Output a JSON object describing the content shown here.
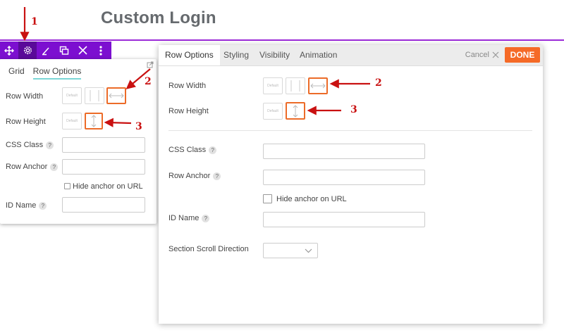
{
  "page": {
    "title": "Custom Login"
  },
  "toolbar": {
    "buttons": [
      {
        "icon": "move-icon"
      },
      {
        "icon": "gear-icon"
      },
      {
        "icon": "brush-icon"
      },
      {
        "icon": "duplicate-icon"
      },
      {
        "icon": "close-icon"
      },
      {
        "icon": "more-icon"
      }
    ]
  },
  "mini_panel": {
    "tabs": [
      "Grid",
      "Row Options"
    ],
    "active_tab": "Row Options",
    "row_width_label": "Row Width",
    "row_height_label": "Row Height",
    "css_class_label": "CSS Class",
    "row_anchor_label": "Row Anchor",
    "hide_anchor_label": "Hide anchor on URL",
    "id_name_label": "ID Name",
    "help_mark": "?",
    "default_label": "Default"
  },
  "big_panel": {
    "tabs": [
      "Row Options",
      "Styling",
      "Visibility",
      "Animation"
    ],
    "active_tab": "Row Options",
    "cancel_label": "Cancel",
    "done_label": "DONE",
    "row_width_label": "Row Width",
    "row_height_label": "Row Height",
    "css_class_label": "CSS Class",
    "row_anchor_label": "Row Anchor",
    "hide_anchor_label": "Hide anchor on URL",
    "id_name_label": "ID Name",
    "scroll_direction_label": "Section Scroll Direction",
    "help_mark": "?",
    "default_label": "Default",
    "scroll_direction_value": ""
  },
  "callouts": {
    "one": "1",
    "two": "2",
    "three": "3"
  },
  "colors": {
    "toolbar": "#7c0fd0",
    "accent_line": "#9b2ad8",
    "done": "#f56a27",
    "selected_border": "#ec6b28",
    "annotation": "#c91111"
  }
}
